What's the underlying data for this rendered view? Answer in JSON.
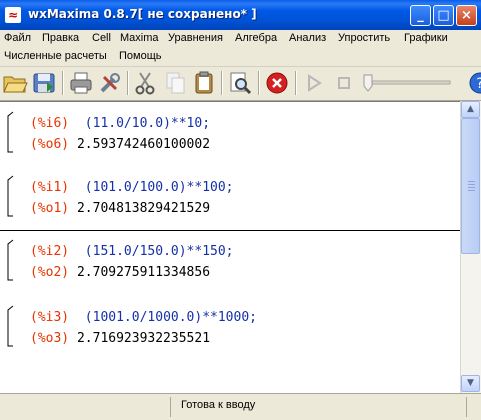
{
  "window": {
    "title": "wxMaxima 0.8.7[ не сохранено* ]"
  },
  "menu": {
    "row1": [
      "Файл",
      "Правка",
      "Cell",
      "Maxima",
      "Уравнения",
      "Алгебра",
      "Анализ",
      "Упростить",
      "Графики"
    ],
    "row2": [
      "Численные расчеты",
      "Помощь"
    ]
  },
  "toolbar": {
    "buttons": [
      "open-icon",
      "save-icon",
      "print-icon",
      "preferences-icon",
      "cut-icon",
      "copy-icon",
      "paste-icon",
      "find-icon",
      "interrupt-icon",
      "play-icon",
      "stop-icon"
    ],
    "slider_value": 0,
    "colors": {
      "interrupt": "#d42020",
      "disabled": "#b8b8b8"
    }
  },
  "cells": [
    {
      "in_label": "(%i6)",
      "input": "(11.0/10.0)**10;",
      "out_label": "(%o6)",
      "output": "2.593742460100002"
    },
    {
      "in_label": "(%i1)",
      "input": "(101.0/100.0)**100;",
      "out_label": "(%o1)",
      "output": "2.704813829421529"
    },
    {
      "in_label": "(%i2)",
      "input": "(151.0/150.0)**150;",
      "out_label": "(%o2)",
      "output": "2.709275911334856"
    },
    {
      "in_label": "(%i3)",
      "input": "(1001.0/1000.0)**1000;",
      "out_label": "(%o3)",
      "output": "2.716923932235521"
    }
  ],
  "colors": {
    "label": "#e63300",
    "input": "#1530a8",
    "output": "#000000",
    "title_bar": "#0058e6"
  },
  "status": {
    "text": "Готова к вводу"
  }
}
